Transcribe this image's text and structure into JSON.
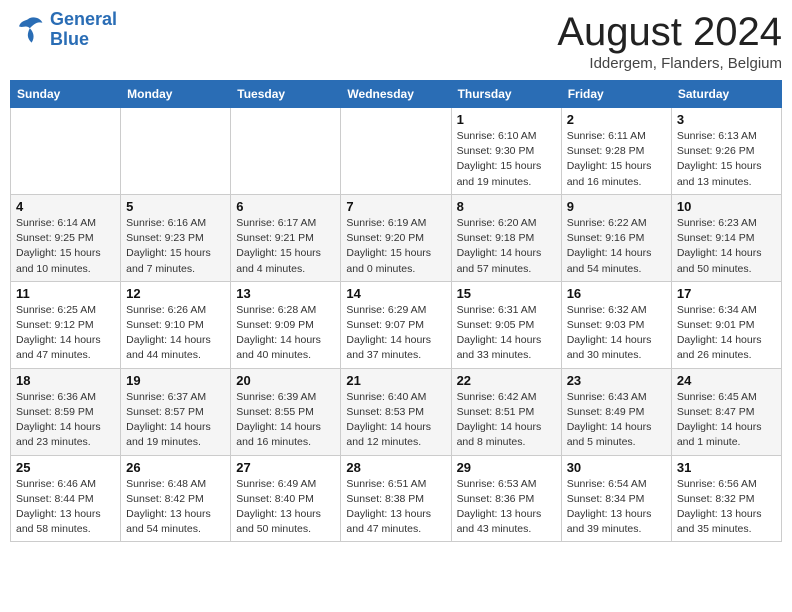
{
  "header": {
    "logo_line1": "General",
    "logo_line2": "Blue",
    "month_title": "August 2024",
    "location": "Iddergem, Flanders, Belgium"
  },
  "days_of_week": [
    "Sunday",
    "Monday",
    "Tuesday",
    "Wednesday",
    "Thursday",
    "Friday",
    "Saturday"
  ],
  "weeks": [
    [
      {
        "day": "",
        "info": ""
      },
      {
        "day": "",
        "info": ""
      },
      {
        "day": "",
        "info": ""
      },
      {
        "day": "",
        "info": ""
      },
      {
        "day": "1",
        "info": "Sunrise: 6:10 AM\nSunset: 9:30 PM\nDaylight: 15 hours\nand 19 minutes."
      },
      {
        "day": "2",
        "info": "Sunrise: 6:11 AM\nSunset: 9:28 PM\nDaylight: 15 hours\nand 16 minutes."
      },
      {
        "day": "3",
        "info": "Sunrise: 6:13 AM\nSunset: 9:26 PM\nDaylight: 15 hours\nand 13 minutes."
      }
    ],
    [
      {
        "day": "4",
        "info": "Sunrise: 6:14 AM\nSunset: 9:25 PM\nDaylight: 15 hours\nand 10 minutes."
      },
      {
        "day": "5",
        "info": "Sunrise: 6:16 AM\nSunset: 9:23 PM\nDaylight: 15 hours\nand 7 minutes."
      },
      {
        "day": "6",
        "info": "Sunrise: 6:17 AM\nSunset: 9:21 PM\nDaylight: 15 hours\nand 4 minutes."
      },
      {
        "day": "7",
        "info": "Sunrise: 6:19 AM\nSunset: 9:20 PM\nDaylight: 15 hours\nand 0 minutes."
      },
      {
        "day": "8",
        "info": "Sunrise: 6:20 AM\nSunset: 9:18 PM\nDaylight: 14 hours\nand 57 minutes."
      },
      {
        "day": "9",
        "info": "Sunrise: 6:22 AM\nSunset: 9:16 PM\nDaylight: 14 hours\nand 54 minutes."
      },
      {
        "day": "10",
        "info": "Sunrise: 6:23 AM\nSunset: 9:14 PM\nDaylight: 14 hours\nand 50 minutes."
      }
    ],
    [
      {
        "day": "11",
        "info": "Sunrise: 6:25 AM\nSunset: 9:12 PM\nDaylight: 14 hours\nand 47 minutes."
      },
      {
        "day": "12",
        "info": "Sunrise: 6:26 AM\nSunset: 9:10 PM\nDaylight: 14 hours\nand 44 minutes."
      },
      {
        "day": "13",
        "info": "Sunrise: 6:28 AM\nSunset: 9:09 PM\nDaylight: 14 hours\nand 40 minutes."
      },
      {
        "day": "14",
        "info": "Sunrise: 6:29 AM\nSunset: 9:07 PM\nDaylight: 14 hours\nand 37 minutes."
      },
      {
        "day": "15",
        "info": "Sunrise: 6:31 AM\nSunset: 9:05 PM\nDaylight: 14 hours\nand 33 minutes."
      },
      {
        "day": "16",
        "info": "Sunrise: 6:32 AM\nSunset: 9:03 PM\nDaylight: 14 hours\nand 30 minutes."
      },
      {
        "day": "17",
        "info": "Sunrise: 6:34 AM\nSunset: 9:01 PM\nDaylight: 14 hours\nand 26 minutes."
      }
    ],
    [
      {
        "day": "18",
        "info": "Sunrise: 6:36 AM\nSunset: 8:59 PM\nDaylight: 14 hours\nand 23 minutes."
      },
      {
        "day": "19",
        "info": "Sunrise: 6:37 AM\nSunset: 8:57 PM\nDaylight: 14 hours\nand 19 minutes."
      },
      {
        "day": "20",
        "info": "Sunrise: 6:39 AM\nSunset: 8:55 PM\nDaylight: 14 hours\nand 16 minutes."
      },
      {
        "day": "21",
        "info": "Sunrise: 6:40 AM\nSunset: 8:53 PM\nDaylight: 14 hours\nand 12 minutes."
      },
      {
        "day": "22",
        "info": "Sunrise: 6:42 AM\nSunset: 8:51 PM\nDaylight: 14 hours\nand 8 minutes."
      },
      {
        "day": "23",
        "info": "Sunrise: 6:43 AM\nSunset: 8:49 PM\nDaylight: 14 hours\nand 5 minutes."
      },
      {
        "day": "24",
        "info": "Sunrise: 6:45 AM\nSunset: 8:47 PM\nDaylight: 14 hours\nand 1 minute."
      }
    ],
    [
      {
        "day": "25",
        "info": "Sunrise: 6:46 AM\nSunset: 8:44 PM\nDaylight: 13 hours\nand 58 minutes."
      },
      {
        "day": "26",
        "info": "Sunrise: 6:48 AM\nSunset: 8:42 PM\nDaylight: 13 hours\nand 54 minutes."
      },
      {
        "day": "27",
        "info": "Sunrise: 6:49 AM\nSunset: 8:40 PM\nDaylight: 13 hours\nand 50 minutes."
      },
      {
        "day": "28",
        "info": "Sunrise: 6:51 AM\nSunset: 8:38 PM\nDaylight: 13 hours\nand 47 minutes."
      },
      {
        "day": "29",
        "info": "Sunrise: 6:53 AM\nSunset: 8:36 PM\nDaylight: 13 hours\nand 43 minutes."
      },
      {
        "day": "30",
        "info": "Sunrise: 6:54 AM\nSunset: 8:34 PM\nDaylight: 13 hours\nand 39 minutes."
      },
      {
        "day": "31",
        "info": "Sunrise: 6:56 AM\nSunset: 8:32 PM\nDaylight: 13 hours\nand 35 minutes."
      }
    ]
  ]
}
